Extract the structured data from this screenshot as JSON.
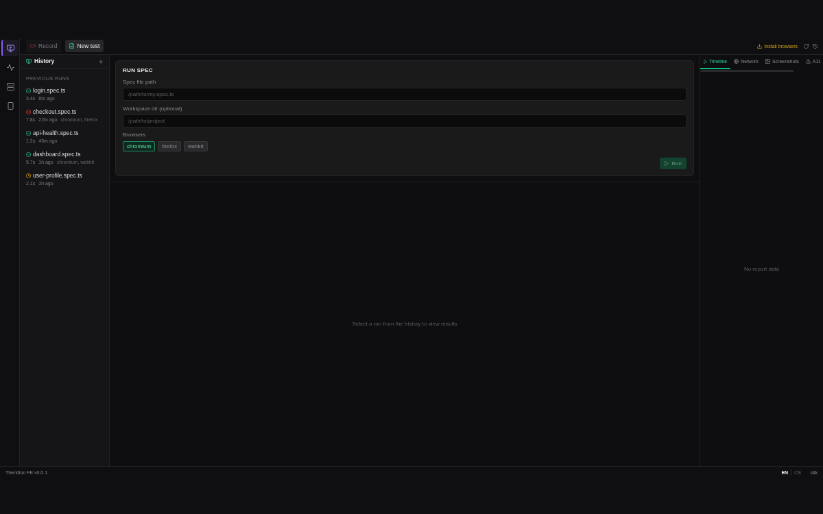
{
  "rail": [
    {
      "selected": true
    },
    {
      "selected": false
    },
    {
      "selected": false
    },
    {
      "selected": false
    }
  ],
  "toolbar": {
    "modes": [
      {
        "label": "Record",
        "selected": false
      },
      {
        "label": "New test",
        "selected": true
      }
    ],
    "install_label": "Install browsers"
  },
  "history": {
    "title": "History",
    "section": "PREVIOUS RUNS",
    "runs": [
      {
        "kind": "passed",
        "name": "login.spec.ts",
        "duration": "3.4s",
        "age": "8m ago"
      },
      {
        "kind": "failed",
        "name": "checkout.spec.ts",
        "duration": "7.8s",
        "age": "22m ago",
        "browsers": "chromium, firefox"
      },
      {
        "kind": "passed",
        "name": "api-health.spec.ts",
        "duration": "1.2s",
        "age": "45m ago"
      },
      {
        "kind": "passed",
        "name": "dashboard.spec.ts",
        "duration": "5.7s",
        "age": "1h ago",
        "browsers": "chromium, webkit"
      },
      {
        "kind": "flaky",
        "name": "user-profile.spec.ts",
        "duration": "2.1s",
        "age": "3h ago"
      }
    ]
  },
  "run_spec": {
    "title": "RUN SPEC",
    "fields": [
      {
        "label": "Spec file path",
        "placeholder": "/path/to/my.spec.ts"
      },
      {
        "label": "Workspace dir (optional)",
        "placeholder": "/path/to/project"
      }
    ],
    "browsers_label": "Browsers",
    "browsers": [
      {
        "label": "chromium",
        "selected": true
      },
      {
        "label": "firefox",
        "selected": false
      },
      {
        "label": "webkit",
        "selected": false
      }
    ],
    "run_button": {
      "label": "Run",
      "disabled": true
    }
  },
  "results": {
    "empty_message": "Select a run from the history to view results"
  },
  "report": {
    "tabs": [
      {
        "label": "Timeline",
        "selected": true
      },
      {
        "label": "Network",
        "selected": false
      },
      {
        "label": "Screenshots",
        "selected": false
      },
      {
        "label": "A11",
        "selected": false
      }
    ],
    "empty_message": "No report data"
  },
  "footer": {
    "version": "Theridion FE v0.0.1",
    "languages": [
      {
        "label": "EN",
        "selected": true
      },
      {
        "label": "CS",
        "selected": false
      }
    ],
    "theme": "silk"
  }
}
